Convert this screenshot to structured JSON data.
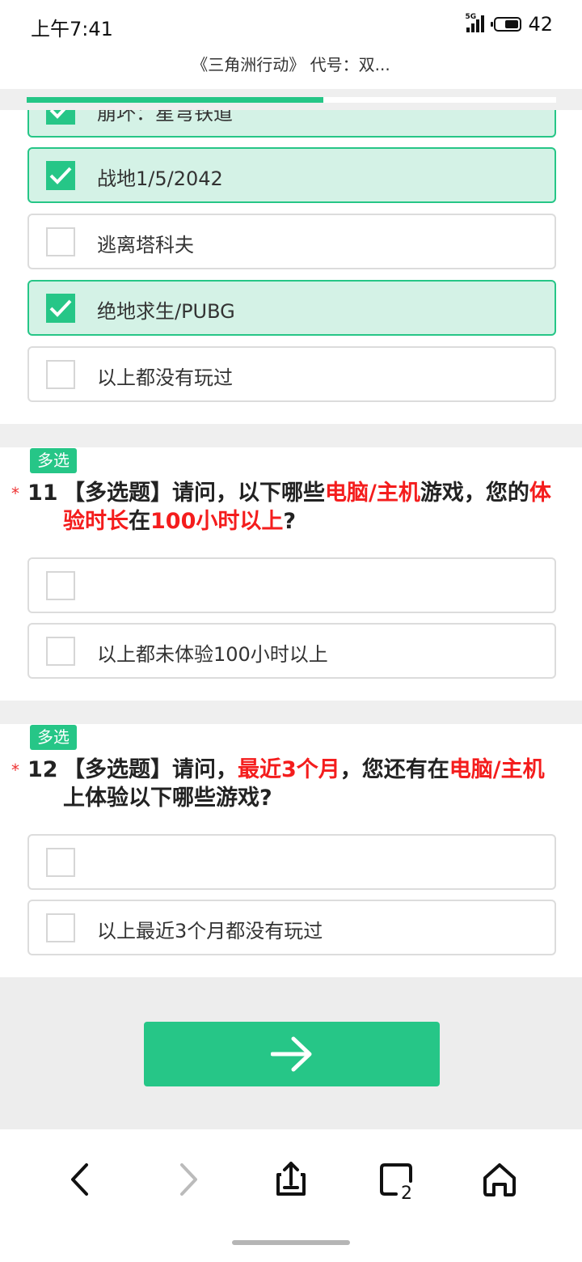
{
  "status_bar": {
    "time": "上午7:41",
    "network": "5G",
    "battery": "42"
  },
  "page_title": "《三角洲行动》 代号：双...",
  "progress": {
    "fraction": 0.56
  },
  "q10_options": [
    {
      "label": "崩坏：星穹铁道",
      "checked": true
    },
    {
      "label": "战地1/5/2042",
      "checked": true
    },
    {
      "label": "逃离塔科夫",
      "checked": false
    },
    {
      "label": "绝地求生/PUBG",
      "checked": true
    },
    {
      "label": "以上都没有玩过",
      "checked": false
    }
  ],
  "q11": {
    "badge": "多选",
    "required_mark": "*",
    "number": "11",
    "text_parts": [
      "【多选题】请问，以下哪些",
      "电脑/主机",
      "游戏，您的",
      "体验时长",
      "在",
      "100小时以上",
      "?"
    ],
    "options": [
      {
        "label": "",
        "checked": false
      },
      {
        "label": "以上都未体验100小时以上",
        "checked": false
      }
    ]
  },
  "q12": {
    "badge": "多选",
    "required_mark": "*",
    "number": "12",
    "text_parts": [
      "【多选题】请问，",
      "最近3个月",
      "，您还有在",
      "电脑/主机",
      "上体验以下哪些游戏?"
    ],
    "options": [
      {
        "label": "",
        "checked": false
      },
      {
        "label": "以上最近3个月都没有玩过",
        "checked": false
      }
    ]
  },
  "icons": {
    "next": "arrow-right-icon",
    "back": "chevron-left-icon",
    "forward": "chevron-right-icon",
    "share": "share-icon",
    "tabs": "tabs-icon",
    "home": "home-icon"
  },
  "browser_nav": {
    "tab_count": "2"
  },
  "colors": {
    "accent": "#26c687",
    "highlight": "#f41d1d",
    "checked_bg": "#d4f2e6"
  }
}
